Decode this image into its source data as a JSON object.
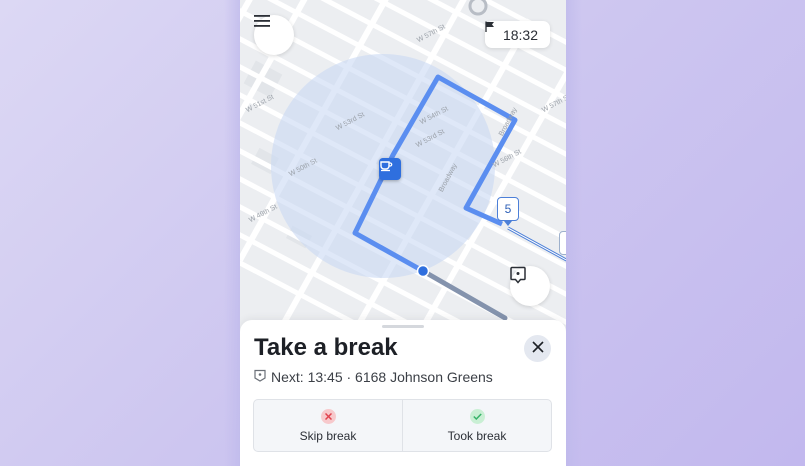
{
  "map": {
    "street_labels": [
      "W 57th St",
      "W 56th St",
      "W 55th St",
      "W 54th St",
      "W 53rd St",
      "W 52nd St",
      "W 51st St",
      "W 50th St",
      "W 49th St",
      "Broadway"
    ],
    "time": "18:32",
    "stop_number": "5",
    "colors": {
      "route": "#5b8ef0",
      "route_done": "#8493ad",
      "radius": "#c9d9f3",
      "pin": "#2f6fde"
    },
    "icons": {
      "menu": "hamburger-menu-icon",
      "flag": "flag-icon",
      "coffee": "coffee-cup-icon",
      "report": "report-issue-icon"
    }
  },
  "sheet": {
    "title": "Take a break",
    "next": "Next: 13:45 · 6168 Johnson Greens",
    "actions": [
      {
        "label": "Skip break",
        "icon": "x-circle-icon",
        "color": "#e0434f"
      },
      {
        "label": "Took break",
        "icon": "check-circle-icon",
        "color": "#38b36a"
      }
    ]
  }
}
